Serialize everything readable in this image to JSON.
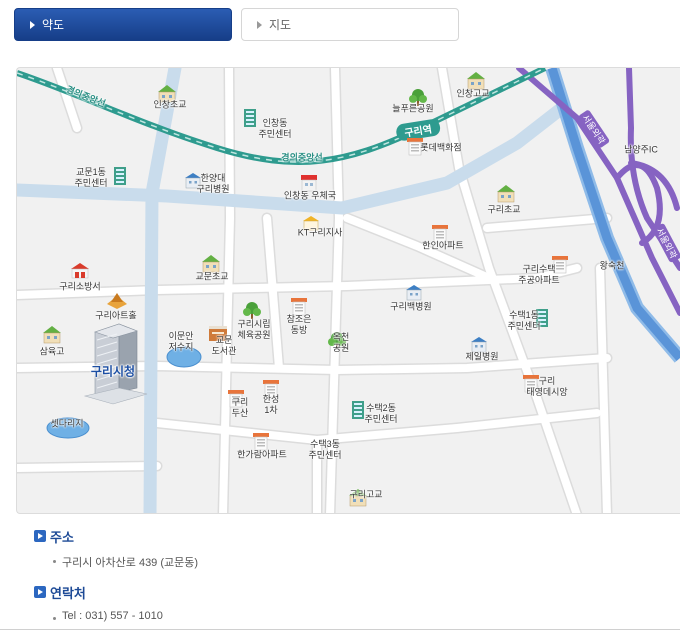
{
  "tabs": {
    "sketch_map": "약도",
    "map": "지도"
  },
  "map": {
    "rail_line": "경의중앙선",
    "rail_line_2": "경의중앙선",
    "station": "구리역",
    "expressway": "서울외곽",
    "expressway_2": "서울외곽",
    "interchange": "남양주IC",
    "river": "왕숙천",
    "city_hall": "구리시청",
    "places": {
      "inchang_elem": "인창초교",
      "inchang_center": "인창동\n주민센터",
      "neulpureun_park": "늘푸른공원",
      "inchang_high": "인창고교",
      "lotte": "롯데백화점",
      "gyomun1_center": "교문1동\n주민센터",
      "hanyang_hosp": "한양대\n구리병원",
      "inchang_post": "인창동 우체국",
      "guri_elem": "구리초교",
      "kt": "KT구리지사",
      "hanin_apt": "한인아파트",
      "fire_station": "구리소방서",
      "gyomun_elem": "교문초교",
      "sutaek_jugong": "구리수택\n주공아파트",
      "art_hall": "구리아트홀",
      "baek_hosp": "구리백병원",
      "sutaek1_center": "수택1동\n주민센터",
      "sahmyook": "삼육고",
      "imunan": "이문안\n저수지",
      "gyomun_lib": "교문\n도서관",
      "sports_park": "구리시립\n체육공원",
      "chamjoeun": "참조은\n동방",
      "okcheon_park": "옥천\n공원",
      "jeil_hosp": "제일병원",
      "taeyoung": "구리\n태영데시앙",
      "setdari": "셋다리지",
      "doosan": "구리\n두산",
      "hansung": "한성\n1차",
      "sutaek2_center": "수택2동\n주민센터",
      "hangaram": "한가람아파트",
      "sutaek3_center": "수택3동\n주민센터",
      "guri_high": "구리고교"
    }
  },
  "info": {
    "address": {
      "heading": "주소",
      "value": "구리시 아차산로 439 (교문동)"
    },
    "contact": {
      "heading": "연락처",
      "value": "Tel : 031) 557 - 1010"
    }
  },
  "colors": {
    "accent": "#1d4796",
    "rail": "#2e9b8f",
    "expressway": "#8663c2",
    "river": "#5a94d8",
    "major_road": "#c9dcec"
  }
}
